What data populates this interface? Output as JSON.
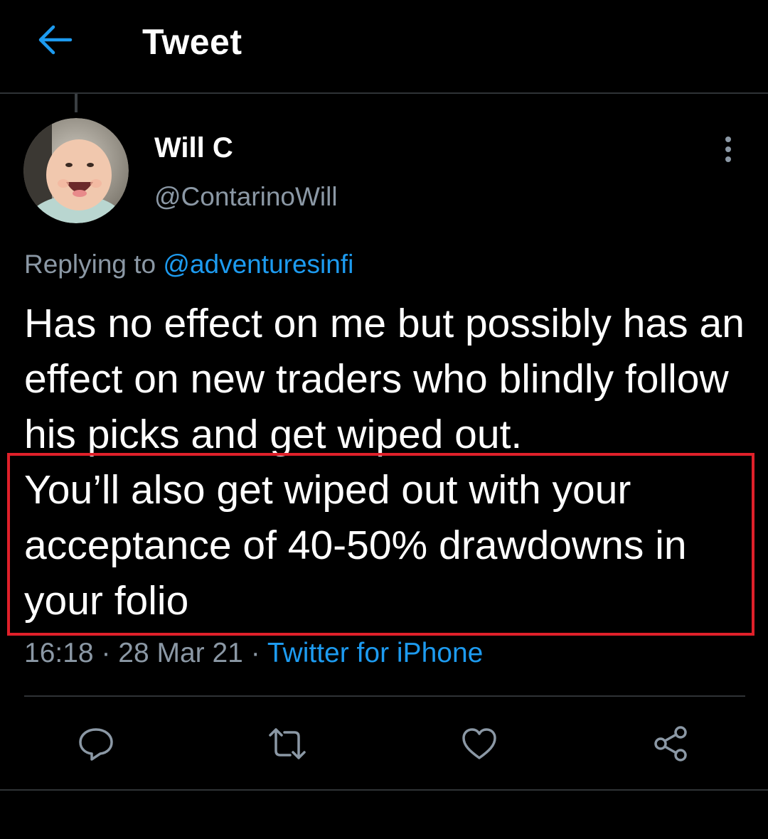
{
  "header": {
    "title": "Tweet",
    "back_icon": "arrow-left-icon"
  },
  "tweet": {
    "author_name": "Will C",
    "author_handle": "@ContarinoWill",
    "replying_prefix": "Replying to ",
    "replying_to": "@adventuresinfi",
    "text_part1": "Has no effect on me but possibly has an effect on new traders who blindly follow his picks and get wiped out.",
    "text_part2": "You’ll also get wiped out with your acceptance of 40-50% drawdowns in your folio",
    "time": "16:18",
    "separator1": " · ",
    "date": "28 Mar 21",
    "separator2": " · ",
    "source": "Twitter for iPhone"
  },
  "actions": [
    {
      "name": "reply",
      "icon": "reply-icon"
    },
    {
      "name": "retweet",
      "icon": "retweet-icon"
    },
    {
      "name": "like",
      "icon": "heart-icon"
    },
    {
      "name": "share",
      "icon": "share-icon"
    }
  ],
  "colors": {
    "background": "#000000",
    "text_primary": "#ffffff",
    "text_secondary": "#8b98a5",
    "accent": "#1d9bf0",
    "highlight_box": "#e0202a",
    "divider": "#2f3336"
  }
}
